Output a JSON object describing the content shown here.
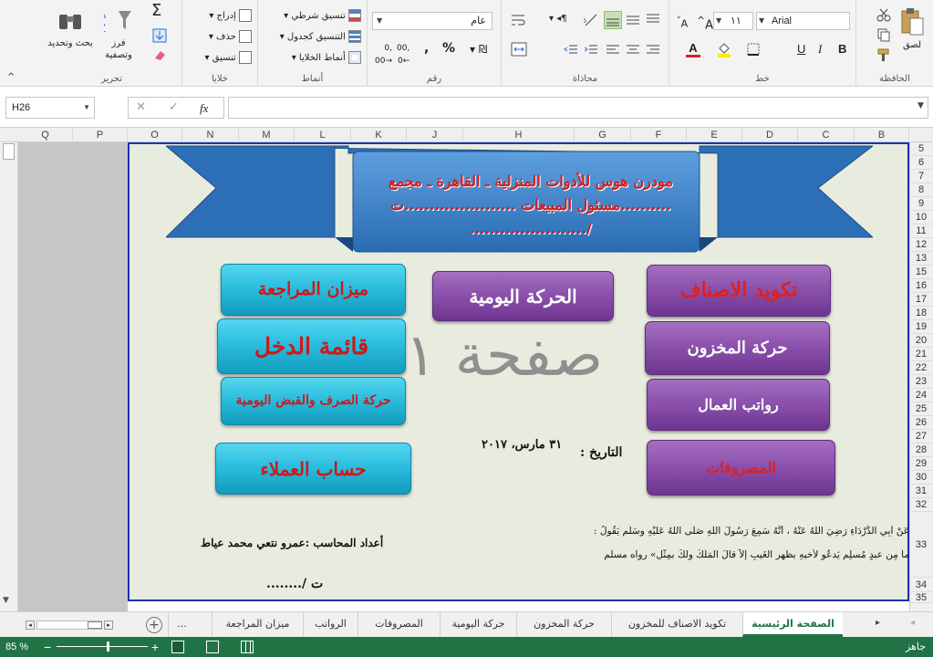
{
  "ribbon": {
    "clipboard": {
      "label": "الحافظة",
      "paste": "لصق"
    },
    "font": {
      "label": "خط",
      "font_name": "Arial",
      "font_size": "١١",
      "bold": "B",
      "italic": "I",
      "underline": "U"
    },
    "alignment": {
      "label": "محاذاة"
    },
    "number": {
      "label": "رقم",
      "format": "عام",
      "percent": "%"
    },
    "styles": {
      "label": "أنماط",
      "conditional": "تنسيق شرطي",
      "table": "التنسيق كجدول",
      "cell_styles": "أنماط الخلايا"
    },
    "cells": {
      "label": "خلايا",
      "insert": "إدراج",
      "delete": "حذف",
      "format": "تنسيق"
    },
    "editing": {
      "label": "تحرير",
      "sort": "فرز وتصفية",
      "find": "بحث وتحديد",
      "sigma": "Σ"
    }
  },
  "formula_bar": {
    "name_box": "H26",
    "fx": "fx",
    "value": ""
  },
  "columns": [
    "Q",
    "P",
    "O",
    "N",
    "M",
    "L",
    "K",
    "J",
    "H",
    "G",
    "F",
    "E",
    "D",
    "C",
    "B"
  ],
  "rows": [
    "5",
    "6",
    "7",
    "8",
    "9",
    "10",
    "11",
    "12",
    "13",
    "15",
    "16",
    "17",
    "18",
    "19",
    "20",
    "21",
    "22",
    "23",
    "24",
    "25",
    "26",
    "27",
    "28",
    "29",
    "30",
    "31",
    "32",
    "33",
    "34",
    "35"
  ],
  "sheet": {
    "banner_lines": [
      "مودرن هوس للأدوات المنزلية ـ القاهرة ـ مجمع",
      "..........مسئول المبيعات ......................ت",
      "/......................."
    ],
    "buttons": {
      "codes": "تكويد الاصناف",
      "daily": "الحركة اليومية",
      "trial": "ميزان المراجعة",
      "stock": "حركة المخزون",
      "income": "قائمة الدخل",
      "salaries": "رواتب العمال",
      "cash": "حركة الصرف والقبض اليومية",
      "expenses": "المصروفات",
      "customers": "حساب العملاء"
    },
    "watermark": "صفحة ١",
    "date_label": "التاريخ :",
    "date_value": "٣١ مارس، ٢٠١٧",
    "hadith_line1": "عَنْ أَبِي الدَّرْدَاءِ رَضِيَ اللَّهُ عَنْهُ ، أَنَّهُ سَمِعَ رَسُولَ اللَّهِ صَلَّى اللهُ عَلَيْهِ وسَلَّم يَقُولُ :",
    "hadith_line2": "ما مِن عبدٍ مُسلِمٍ يَدعُو لأخيهِ بظهرِ الغَيبِ إلاَّ قالَ المَلَكُ ولكَ بمِثْلٍ» رواه مسلم",
    "accountant": "أعداد المحاسب :عمرو نتعي محمد عياط",
    "tel": "ت /........"
  },
  "tabs": [
    "الصفحة الرئيسية",
    "تكويد الاصناف للمخزون",
    "حركة المخزون",
    "حركة اليومية",
    "المصروفات",
    "الرواتب",
    "ميزان المراجعة",
    "..."
  ],
  "status": {
    "ready": "جاهز",
    "zoom": "85 %"
  },
  "colors": {
    "accent": "#217346",
    "canvas": "#e8ecde",
    "banner": "#3a7fc4",
    "purple_button": "#8c52ad",
    "teal_button": "#28bbdc"
  }
}
